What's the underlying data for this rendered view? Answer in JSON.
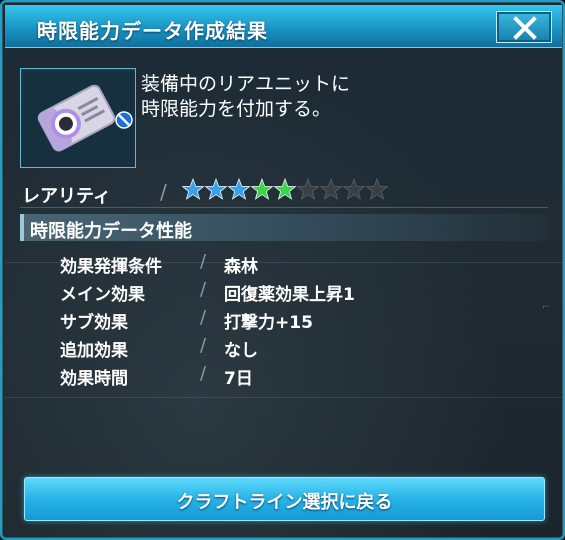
{
  "window": {
    "title": "時限能力データ作成結果",
    "close_label": "✕"
  },
  "item": {
    "icon": "rear-unit-data-card-icon",
    "restriction_icon": "no-entry-icon",
    "description": "装備中のリアユニットに\n時限能力を付加する。"
  },
  "rarity": {
    "label": "レアリティ",
    "separator": "/",
    "stars_total": 9,
    "stars_filled": 5,
    "star_colors": [
      "#3aa0e8",
      "#3aa0e8",
      "#3aa0e8",
      "#3fd24a",
      "#3fd24a"
    ],
    "empty_star_color": "#3a3f44"
  },
  "performance": {
    "header": "時限能力データ性能",
    "separator": "/",
    "rows": [
      {
        "label": "効果発揮条件",
        "value": "森林"
      },
      {
        "label": "メイン効果",
        "value": "回復薬効果上昇1"
      },
      {
        "label": "サブ効果",
        "value": "打撃力+15"
      },
      {
        "label": "追加効果",
        "value": "なし"
      },
      {
        "label": "効果時間",
        "value": "7日"
      }
    ]
  },
  "actions": {
    "back_label": "クラフトライン選択に戻る"
  },
  "colors": {
    "accent": "#1f9fc6",
    "button": "#27b3e8"
  }
}
